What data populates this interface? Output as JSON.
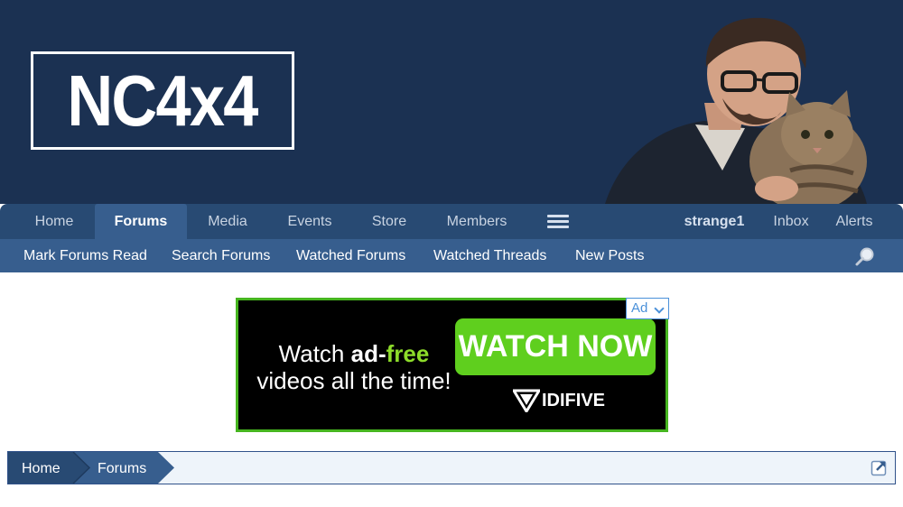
{
  "header": {
    "logo_text": "NC4x4"
  },
  "nav": {
    "tabs": [
      {
        "label": "Home"
      },
      {
        "label": "Forums"
      },
      {
        "label": "Media"
      },
      {
        "label": "Events"
      },
      {
        "label": "Store"
      },
      {
        "label": "Members"
      }
    ],
    "menu_icon": "hamburger-icon",
    "username": "strange1",
    "inbox": "Inbox",
    "alerts": "Alerts"
  },
  "subnav": {
    "items": [
      {
        "label": "Mark Forums Read"
      },
      {
        "label": "Search Forums"
      },
      {
        "label": "Watched Forums"
      },
      {
        "label": "Watched Threads"
      },
      {
        "label": "New Posts"
      }
    ],
    "search_icon": "search-icon"
  },
  "ad": {
    "line1_pre": "Watch ",
    "line1_bold": "ad-",
    "line1_green": "free",
    "line2": "videos all the time!",
    "button": "WATCH NOW",
    "brand": "IDIFIVE",
    "badge": "Ad"
  },
  "breadcrumb": {
    "items": [
      "Home",
      "Forums"
    ],
    "jump_icon": "jump-to-icon"
  },
  "colors": {
    "header_bg": "#1b3152",
    "nav_bg": "#284a73",
    "subnav_bg": "#375e8e",
    "ad_accent": "#5fcf1e",
    "breadcrumb_bg": "#eef4fa"
  }
}
